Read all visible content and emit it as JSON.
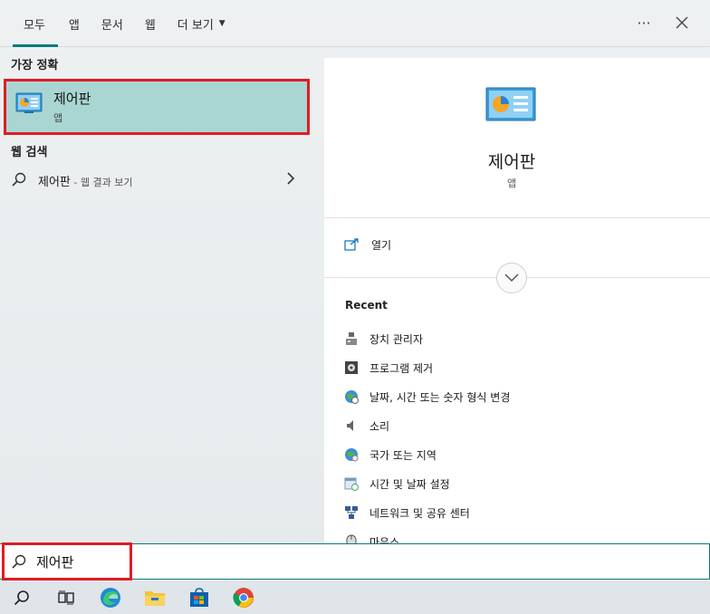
{
  "tabs": [
    {
      "label": "모두",
      "active": true
    },
    {
      "label": "앱",
      "active": false
    },
    {
      "label": "문서",
      "active": false
    },
    {
      "label": "웹",
      "active": false
    },
    {
      "label": "더 보기",
      "active": false
    }
  ],
  "top_icons": {
    "more": "more-icon",
    "close": "close-icon"
  },
  "left": {
    "best_match_title": "가장 정확",
    "best_match": {
      "title": "제어판",
      "subtitle": "앱",
      "icon": "control-panel-icon"
    },
    "web_title": "웹 검색",
    "web_result": {
      "label": "제어판",
      "suffix": " - 웹 결과 보기",
      "icon": "search-icon"
    }
  },
  "right": {
    "title": "제어판",
    "subtitle": "앱",
    "open_label": "열기",
    "recent_title": "Recent",
    "recent": [
      {
        "label": "장치 관리자",
        "icon": "device-manager-icon"
      },
      {
        "label": "프로그램 제거",
        "icon": "uninstall-icon"
      },
      {
        "label": "날짜, 시간 또는 숫자 형식 변경",
        "icon": "globe-clock-icon"
      },
      {
        "label": "소리",
        "icon": "speaker-icon"
      },
      {
        "label": "국가 또는 지역",
        "icon": "globe-icon"
      },
      {
        "label": "시간 및 날짜 설정",
        "icon": "calendar-icon"
      },
      {
        "label": "네트워크 및 공유 센터",
        "icon": "network-icon"
      },
      {
        "label": "마우스",
        "icon": "mouse-icon"
      }
    ]
  },
  "search": {
    "value": "제어판"
  },
  "taskbar": [
    "search-icon",
    "task-view-icon",
    "edge-icon",
    "file-explorer-icon",
    "store-icon",
    "chrome-icon"
  ],
  "colors": {
    "accent": "#0a7a78",
    "highlight": "#e01b24",
    "selected": "#a9d6d3"
  }
}
